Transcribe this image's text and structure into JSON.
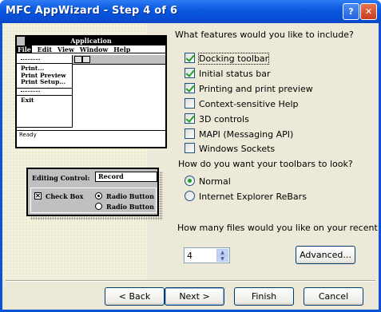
{
  "window": {
    "title": "MFC AppWizard - Step 4 of 6",
    "help_glyph": "?",
    "close_glyph": "✕"
  },
  "illustration": {
    "app_title": "Application",
    "menu": [
      "File",
      "Edit",
      "View",
      "Window",
      "Help"
    ],
    "dropdown": {
      "items": [
        "Print...",
        "Print Preview",
        "Print Setup...",
        "Exit"
      ]
    },
    "status": "Ready",
    "dialog": {
      "editing_label": "Editing Control:",
      "edit_value": "Record",
      "check_box": "Check Box",
      "radio_1": "Radio Button",
      "radio_2": "Radio Button"
    }
  },
  "features": {
    "question": "What features would you like to include?",
    "items": [
      {
        "label": "Docking toolbar",
        "checked": true
      },
      {
        "label": "Initial status bar",
        "checked": true
      },
      {
        "label": "Printing and print preview",
        "checked": true
      },
      {
        "label": "Context-sensitive Help",
        "checked": false
      },
      {
        "label": "3D controls",
        "checked": true
      },
      {
        "label": "MAPI (Messaging API)",
        "checked": false
      },
      {
        "label": "Windows Sockets",
        "checked": false
      }
    ]
  },
  "toolbars": {
    "question": "How do you want your toolbars to look?",
    "options": [
      {
        "label": "Normal",
        "selected": true
      },
      {
        "label": "Internet Explorer ReBars",
        "selected": false
      }
    ]
  },
  "recent": {
    "question": "How many files would you like on your recent file list?",
    "value": "4"
  },
  "buttons": {
    "advanced": "Advanced...",
    "back": "< Back",
    "next": "Next >",
    "finish": "Finish",
    "cancel": "Cancel"
  }
}
